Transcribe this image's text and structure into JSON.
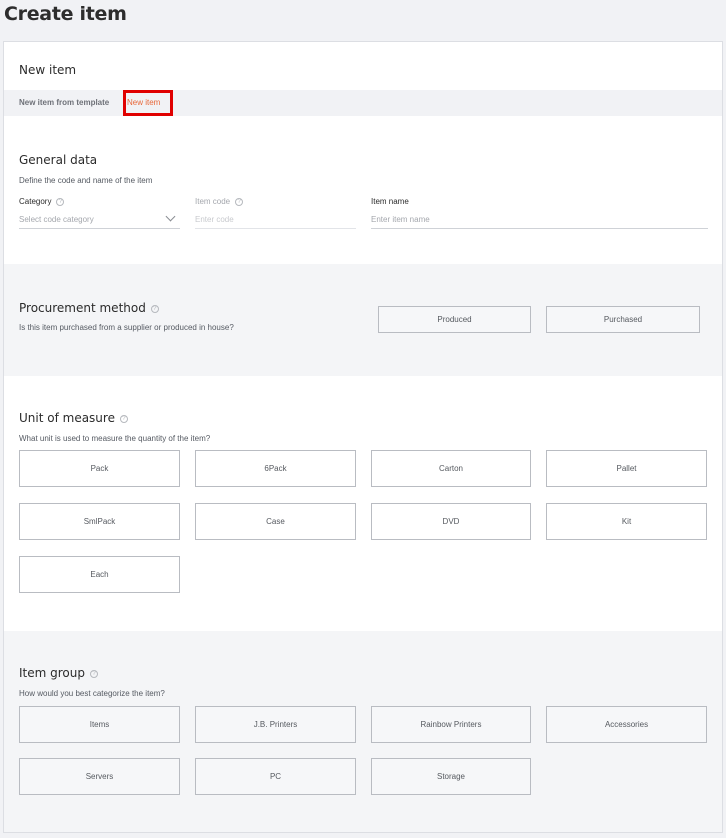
{
  "page": {
    "title": "Create item"
  },
  "card": {
    "title": "New item"
  },
  "tabs": [
    {
      "label": "New item from template",
      "active": false
    },
    {
      "label": "New item",
      "active": true
    }
  ],
  "general": {
    "title": "General data",
    "subtitle": "Define the code and name of the item",
    "category": {
      "label": "Category",
      "placeholder": "Select code category"
    },
    "item_code": {
      "label": "Item code",
      "placeholder": "Enter code"
    },
    "item_name": {
      "label": "Item name",
      "placeholder": "Enter item name"
    }
  },
  "procurement": {
    "title": "Procurement method",
    "subtitle": "Is this item purchased from a supplier or produced in house?",
    "options": [
      "Produced",
      "Purchased"
    ]
  },
  "uom": {
    "title": "Unit of measure",
    "subtitle": "What unit is used to measure the quantity of the item?",
    "options": [
      "Pack",
      "6Pack",
      "Carton",
      "Pallet",
      "SmlPack",
      "Case",
      "DVD",
      "Kit",
      "Each"
    ]
  },
  "item_group": {
    "title": "Item group",
    "subtitle": "How would you best categorize the item?",
    "options": [
      "Items",
      "J.B. Printers",
      "Rainbow Printers",
      "Accessories",
      "Servers",
      "PC",
      "Storage"
    ]
  },
  "icons": {
    "help": "help-circle-icon",
    "dropdown": "chevron-down-icon"
  },
  "colors": {
    "active_tab": "#e8683a",
    "highlight": "#e00000"
  }
}
